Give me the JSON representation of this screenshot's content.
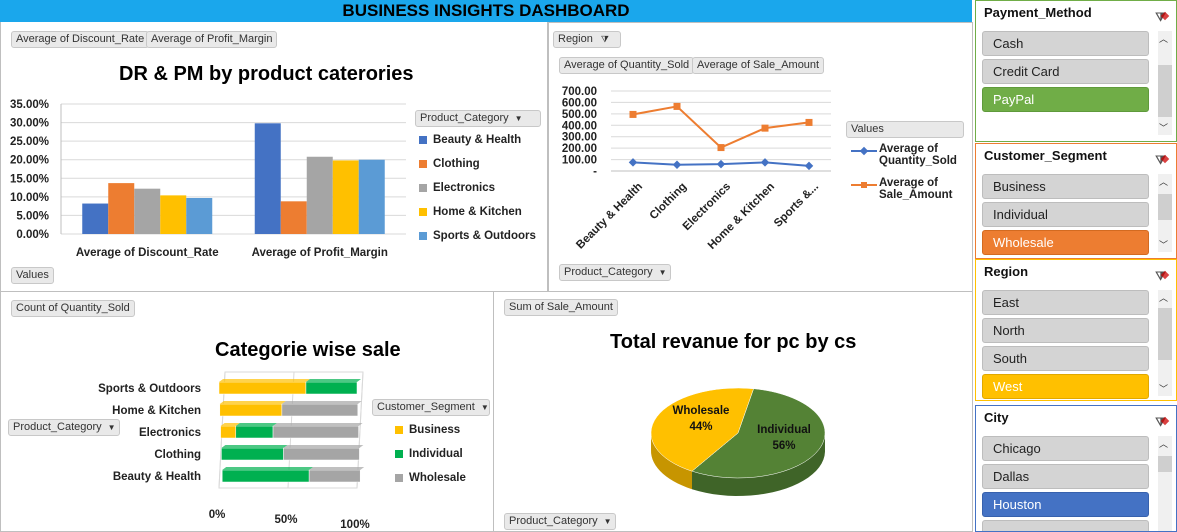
{
  "dashboard_title": "BUSINESS INSIGHTS DASHBOARD",
  "colors": {
    "beauty": "#4472c4",
    "clothing": "#ed7d31",
    "electronics": "#a5a5a5",
    "home": "#ffc000",
    "sports": "#5b9bd5",
    "business": "#ffc000",
    "individual": "#00b050",
    "wholesale": "#a5a5a5",
    "qty_line": "#4472c4",
    "sale_line": "#ed7d31",
    "pie_individual": "#548235",
    "pie_wholesale": "#ffc000",
    "paypal": "#70ad47",
    "wholesale_btn": "#ed7d31",
    "west": "#ffc000",
    "houston": "#4472c4"
  },
  "chart1": {
    "chips": [
      "Average of Discount_Rate",
      "Average of Profit_Margin"
    ],
    "values_chip": "Values",
    "legend_header": "Product_Category",
    "legend": [
      "Beauty & Health",
      "Clothing",
      "Electronics",
      "Home & Kitchen",
      "Sports & Outdoors"
    ],
    "y_ticks": [
      "35.00%",
      "30.00%",
      "25.00%",
      "20.00%",
      "15.00%",
      "10.00%",
      "5.00%",
      "0.00%"
    ]
  },
  "chart2": {
    "region_chip": "Region",
    "chips": [
      "Average of Quantity_Sold",
      "Average of Sale_Amount"
    ],
    "category_chip": "Product_Category",
    "legend_header": "Values",
    "legend_line1": [
      "Average of",
      "Quantity_Sold"
    ],
    "legend_line2": [
      "Average of",
      "Sale_Amount"
    ],
    "y_ticks": [
      "700.00",
      "600.00",
      "500.00",
      "400.00",
      "300.00",
      "200.00",
      "100.00",
      "-"
    ],
    "x_labels": [
      "Beauty & Health",
      "Clothing",
      "Electronics",
      "Home & Kitchen",
      "Sports &..."
    ]
  },
  "chart3": {
    "chip": "Count of Quantity_Sold",
    "category_chip": "Product_Category",
    "legend_header": "Customer_Segment",
    "legend": [
      "Business",
      "Individual",
      "Wholesale"
    ],
    "x_ticks": [
      "0%",
      "50%",
      "100%"
    ]
  },
  "chart4": {
    "chip": "Sum of Sale_Amount",
    "category_chip": "Product_Category",
    "label_wholesale": "Wholesale",
    "label_wholesale_pct": "44%",
    "label_individual": "Individual",
    "label_individual_pct": "56%"
  },
  "chart_data": [
    {
      "type": "bar",
      "title": "DR & PM by product caterories",
      "categories": [
        "Average of Discount_Rate",
        "Average of Profit_Margin"
      ],
      "series": [
        {
          "name": "Beauty & Health",
          "values": [
            0.082,
            0.298
          ]
        },
        {
          "name": "Clothing",
          "values": [
            0.137,
            0.088
          ]
        },
        {
          "name": "Electronics",
          "values": [
            0.122,
            0.208
          ]
        },
        {
          "name": "Home & Kitchen",
          "values": [
            0.104,
            0.198
          ]
        },
        {
          "name": "Sports & Outdoors",
          "values": [
            0.097,
            0.2
          ]
        }
      ],
      "ylim": [
        0,
        0.35
      ],
      "legend": "right"
    },
    {
      "type": "line",
      "categories": [
        "Beauty & Health",
        "Clothing",
        "Electronics",
        "Home & Kitchen",
        "Sports &..."
      ],
      "series": [
        {
          "name": "Average of Quantity_Sold",
          "values": [
            75,
            55,
            60,
            75,
            45
          ]
        },
        {
          "name": "Average of Sale_Amount",
          "values": [
            495,
            565,
            205,
            375,
            425
          ]
        }
      ],
      "ylim": [
        0,
        700
      ],
      "legend": "right"
    },
    {
      "type": "bar",
      "title": "Categorie wise sale",
      "stacked": "100%",
      "orientation": "horizontal",
      "categories": [
        "Sports & Outdoors",
        "Home & Kitchen",
        "Electronics",
        "Clothing",
        "Beauty & Health"
      ],
      "series": [
        {
          "name": "Business",
          "values": [
            0.63,
            0.45,
            0.11,
            0.0,
            0.0
          ]
        },
        {
          "name": "Individual",
          "values": [
            0.37,
            0.0,
            0.27,
            0.45,
            0.63
          ]
        },
        {
          "name": "Wholesale",
          "values": [
            0.0,
            0.55,
            0.62,
            0.55,
            0.37
          ]
        }
      ],
      "legend": "right"
    },
    {
      "type": "pie",
      "title": "Total revanue for pc by cs",
      "labels": [
        "Individual",
        "Wholesale"
      ],
      "values": [
        56,
        44
      ]
    }
  ],
  "slicers": [
    {
      "title": "Payment_Method",
      "items": [
        "Cash",
        "Credit Card",
        "PayPal"
      ],
      "selected": "PayPal"
    },
    {
      "title": "Customer_Segment",
      "items": [
        "Business",
        "Individual",
        "Wholesale"
      ],
      "selected": "Wholesale"
    },
    {
      "title": "Region",
      "items": [
        "East",
        "North",
        "South",
        "West"
      ],
      "selected": "West"
    },
    {
      "title": "City",
      "items": [
        "Chicago",
        "Dallas",
        "Houston"
      ],
      "selected": "Houston"
    }
  ]
}
